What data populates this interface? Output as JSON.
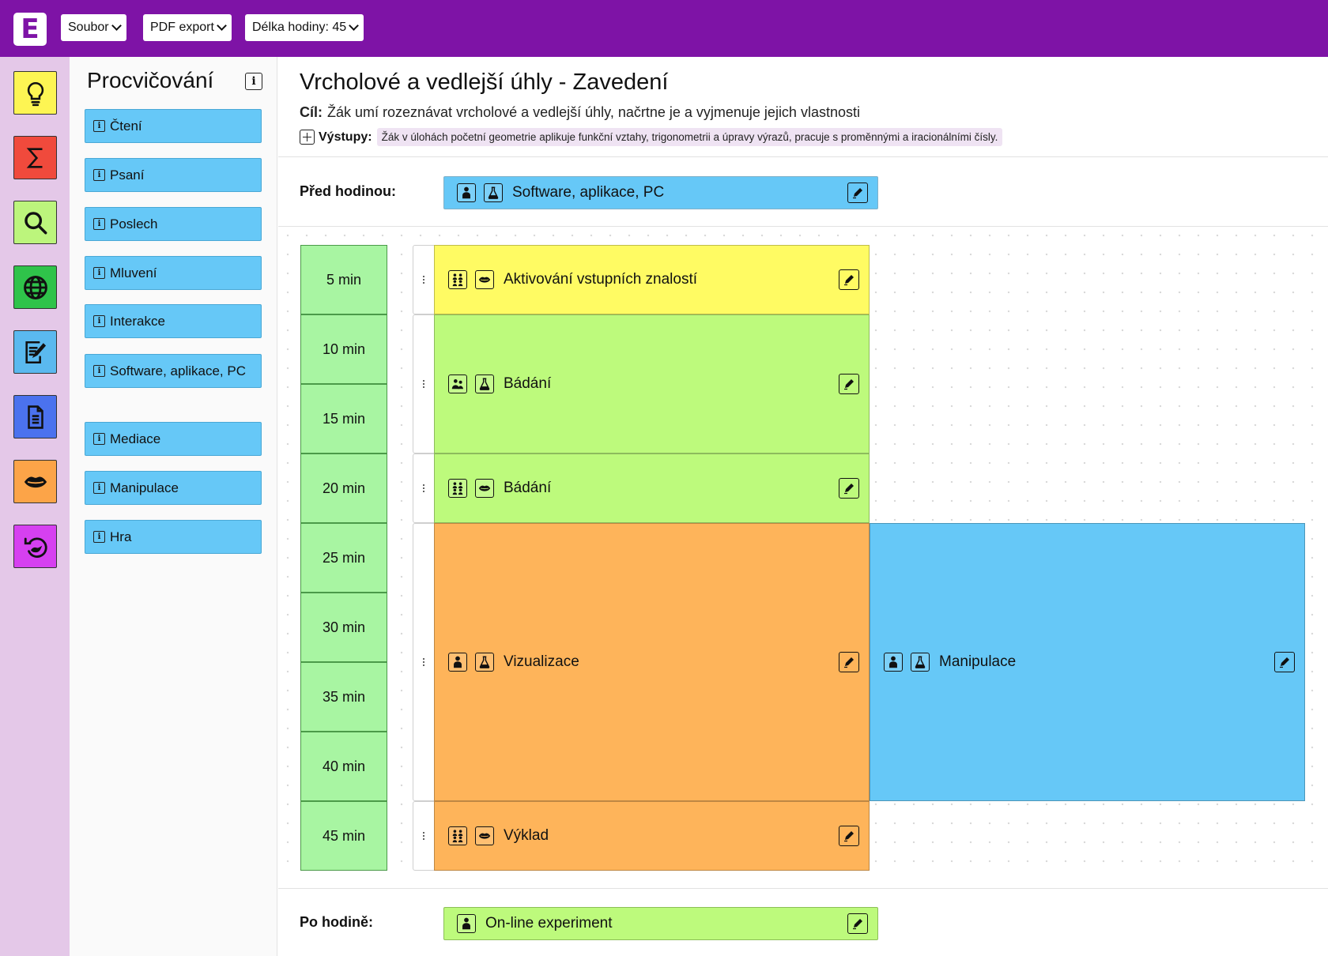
{
  "topbar": {
    "logo": "E",
    "menus": [
      {
        "label": "Soubor"
      },
      {
        "label": "PDF export"
      },
      {
        "label": "Délka hodiny: 45"
      }
    ]
  },
  "rail": {
    "items": [
      {
        "name": "idea",
        "icon": "lightbulb-icon",
        "color": "#fdf553"
      },
      {
        "name": "math",
        "icon": "sigma-icon",
        "color": "#f04a3c"
      },
      {
        "name": "search",
        "icon": "search-icon",
        "color": "#bcf57c"
      },
      {
        "name": "globe",
        "icon": "globe-icon",
        "color": "#2fc34a"
      },
      {
        "name": "write",
        "icon": "edit-document-icon",
        "color": "#5ab9ef"
      },
      {
        "name": "document",
        "icon": "document-icon",
        "color": "#4b72ee"
      },
      {
        "name": "lips",
        "icon": "lips-icon",
        "color": "#fca448"
      },
      {
        "name": "reflection",
        "icon": "undo-head-icon",
        "color": "#d640f0"
      }
    ]
  },
  "palette": {
    "title": "Procvičování",
    "info": "i",
    "items": [
      {
        "label": "Čtení"
      },
      {
        "label": "Psaní"
      },
      {
        "label": "Poslech"
      },
      {
        "label": "Mluvení"
      },
      {
        "label": "Interakce"
      },
      {
        "label": "Software, aplikace, PC"
      },
      {
        "label": "Mediace"
      },
      {
        "label": "Manipulace"
      },
      {
        "label": "Hra"
      }
    ]
  },
  "lesson": {
    "title": "Vrcholové a vedlejší úhly - Zavedení",
    "goal_label": "Cíl:",
    "goal": "Žák umí rozeznávat vrcholové a vedlejší úhly, načrtne je a vyjmenuje jejich vlastnosti",
    "outputs_label": "Výstupy:",
    "outputs": "Žák v úlohách početní geometrie aplikuje funkční vztahy, trigonometrii a úpravy výrazů, pracuje s proměnnými a iracionálními čísly."
  },
  "before": {
    "label": "Před hodinou:",
    "activity": "Software, aplikace, PC",
    "icons": [
      "person-icon",
      "flask-icon"
    ],
    "color": "#66c8f7"
  },
  "after": {
    "label": "Po hodině:",
    "activity": "On-line experiment",
    "icons": [
      "person-icon"
    ],
    "color": "#bdfa7c"
  },
  "timeline": {
    "slots": [
      "5 min",
      "10 min",
      "15 min",
      "20 min",
      "25 min",
      "30 min",
      "35 min",
      "40 min",
      "45 min"
    ],
    "activities": [
      {
        "label": "Aktivování vstupních znalostí",
        "start_min": 0,
        "end_min": 5,
        "lane": 0,
        "icons": [
          "group-icon",
          "lips-icon"
        ],
        "color": "#fffb63"
      },
      {
        "label": "Bádání",
        "start_min": 5,
        "end_min": 15,
        "lane": 0,
        "icons": [
          "pair-icon",
          "flask-icon"
        ],
        "color": "#bdfa7c"
      },
      {
        "label": "Bádání",
        "start_min": 15,
        "end_min": 20,
        "lane": 0,
        "icons": [
          "group-icon",
          "lips-icon"
        ],
        "color": "#bdfa7c"
      },
      {
        "label": "Vizualizace",
        "start_min": 20,
        "end_min": 40,
        "lane": 0,
        "icons": [
          "person-icon",
          "flask-icon"
        ],
        "color": "#feb45a"
      },
      {
        "label": "Manipulace",
        "start_min": 20,
        "end_min": 40,
        "lane": 1,
        "icons": [
          "person-icon",
          "flask-icon"
        ],
        "color": "#66c8f7"
      },
      {
        "label": "Výklad",
        "start_min": 40,
        "end_min": 45,
        "lane": 0,
        "icons": [
          "group-icon",
          "lips-icon"
        ],
        "color": "#feb45a"
      }
    ]
  }
}
